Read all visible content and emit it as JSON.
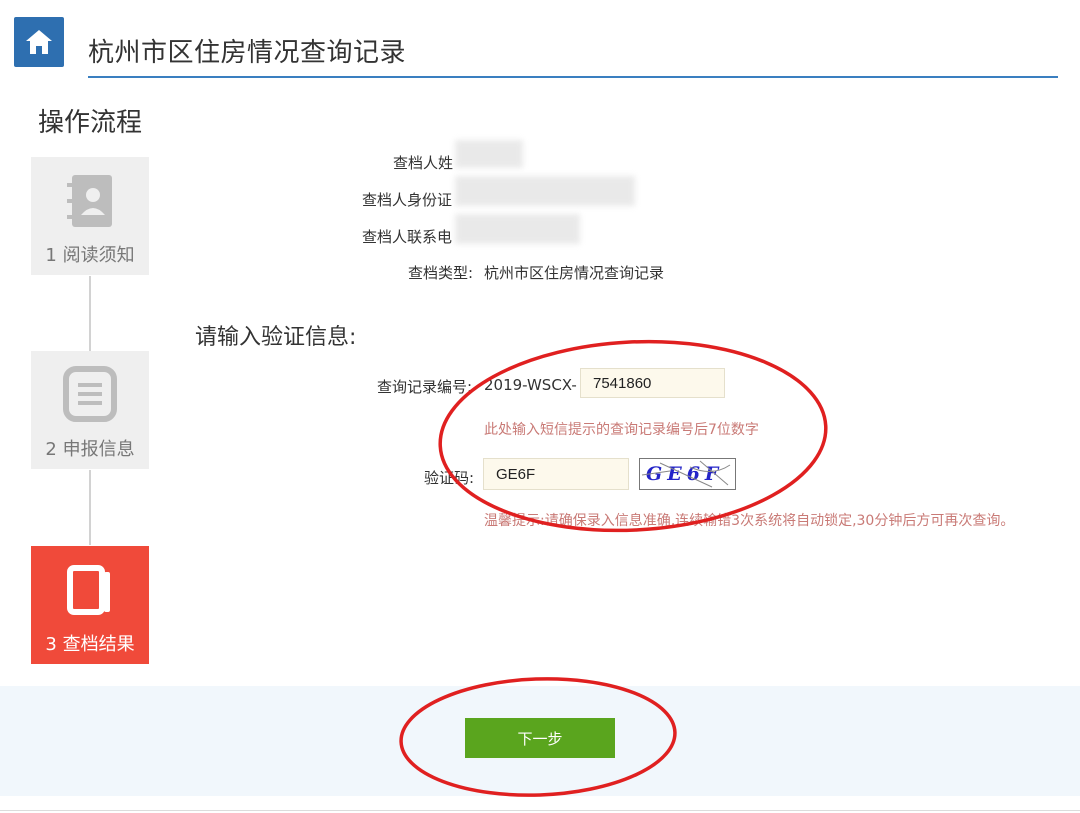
{
  "header": {
    "title": "杭州市区住房情况查询记录",
    "home_icon": "home-icon"
  },
  "process": {
    "title": "操作流程",
    "steps": [
      {
        "label": "1 阅读须知",
        "icon": "contact-book-icon",
        "active": false
      },
      {
        "label": "2 申报信息",
        "icon": "list-document-icon",
        "active": false
      },
      {
        "label": "3 查档结果",
        "icon": "book-icon",
        "active": true
      }
    ]
  },
  "info": {
    "name_label": "查档人姓",
    "id_label": "查档人身份证",
    "phone_label": "查档人联系电",
    "type_label": "查档类型:",
    "type_value": "杭州市区住房情况查询记录"
  },
  "verify": {
    "title": "请输入验证信息:",
    "record_label": "查询记录编号:",
    "record_prefix": "2019-WSCX-",
    "record_value": "7541860",
    "record_hint": "此处输入短信提示的查询记录编号后7位数字",
    "code_label": "验证码:",
    "code_value": "GE6F",
    "captcha_text": "GE6F",
    "warning": "温馨提示:请确保录入信息准确,连续输错3次系统将自动锁定,30分钟后方可再次查询。"
  },
  "footer": {
    "next_label": "下一步"
  },
  "colors": {
    "accent_blue": "#2e6fb0",
    "active_step": "#f04a3a",
    "button_green": "#5aa51e",
    "hint_red": "#c97a76",
    "annotation_red": "#e02020"
  }
}
